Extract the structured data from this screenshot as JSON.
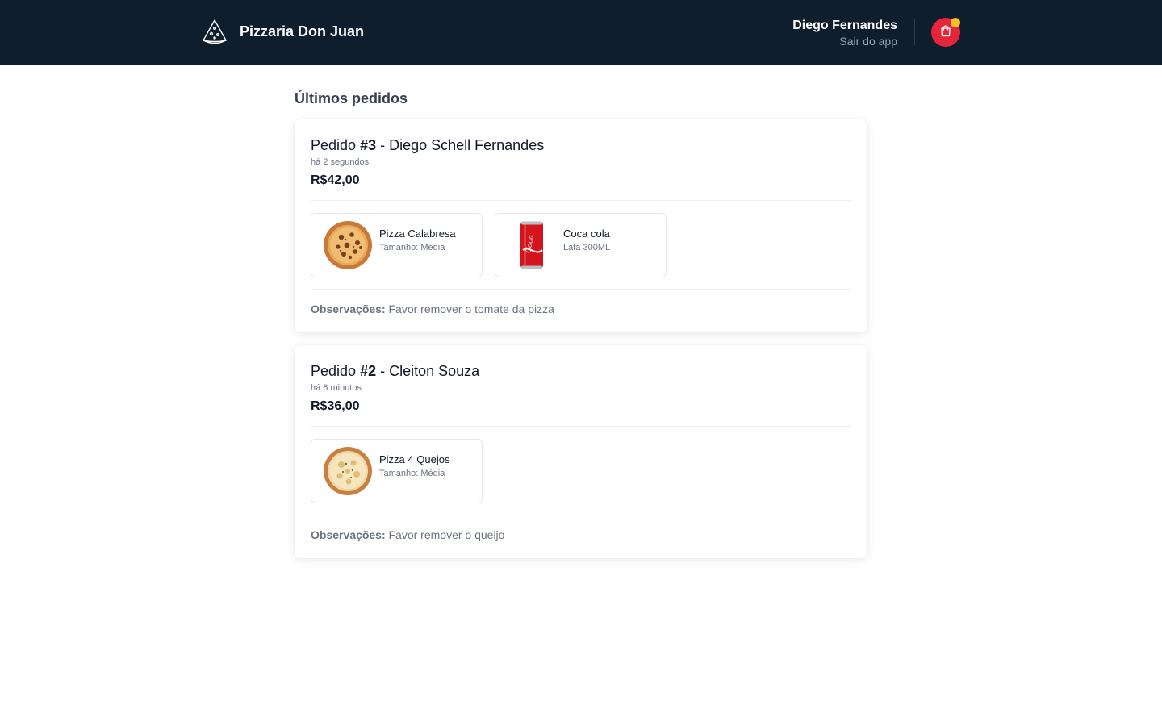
{
  "app": {
    "brand_name": "Pizzaria Don Juan",
    "brand_icon": "pizza-slice-icon"
  },
  "header": {
    "user_name": "Diego Fernandes",
    "logout_label": "Sair do app",
    "cart_icon": "shopping-bag-icon",
    "colors": {
      "background": "#0f1e2c",
      "cart": "#e5263a",
      "badge": "#fbbf24"
    }
  },
  "main": {
    "section_title": "Últimos pedidos",
    "orders": [
      {
        "title_prefix": "Pedido ",
        "number": "#3",
        "title_suffix": " - Diego Schell Fernandes",
        "time": "há 2 segundos",
        "total": "R$42,00",
        "items": [
          {
            "name": "Pizza Calabresa",
            "detail": "Tamanho: Média",
            "image": "pizza-calabresa-image"
          },
          {
            "name": "Coca cola",
            "detail": "Lata 300ML",
            "image": "coke-can-image"
          }
        ],
        "notes_label": "Observações:",
        "notes_text": " Favor remover o tomate da pizza"
      },
      {
        "title_prefix": "Pedido ",
        "number": "#2",
        "title_suffix": " - Cleiton Souza",
        "time": "há 6 minutos",
        "total": "R$36,00",
        "items": [
          {
            "name": "Pizza 4 Quejos",
            "detail": "Tamanho: Média",
            "image": "pizza-4-queijos-image"
          }
        ],
        "notes_label": "Observações:",
        "notes_text": " Favor remover o queijo"
      }
    ]
  }
}
